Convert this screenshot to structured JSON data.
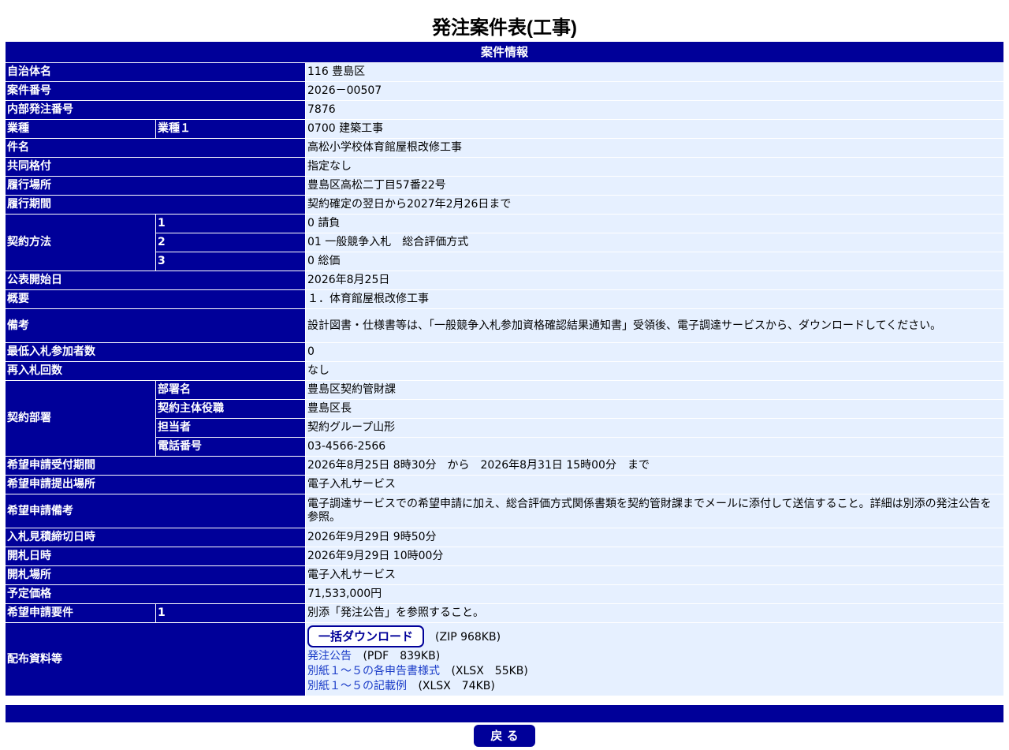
{
  "page": {
    "title": "発注案件表(工事)"
  },
  "section": {
    "title": "案件情報"
  },
  "rows": {
    "jichitai": {
      "label": "自治体名",
      "value": "116 豊島区"
    },
    "anken_no": {
      "label": "案件番号",
      "value": "2026－00507"
    },
    "naibu_no": {
      "label": "内部発注番号",
      "value": "7876"
    },
    "gyoshu": {
      "label": "業種",
      "sub": "業種１",
      "value": "0700 建築工事"
    },
    "kenmei": {
      "label": "件名",
      "value": "高松小学校体育館屋根改修工事"
    },
    "kyodo": {
      "label": "共同格付",
      "value": "指定なし"
    },
    "basho": {
      "label": "履行場所",
      "value": "豊島区高松二丁目57番22号"
    },
    "kikan": {
      "label": "履行期間",
      "value": "契約確定の翌日から2027年2月26日まで"
    },
    "hoho": {
      "label": "契約方法",
      "items": [
        {
          "sub": "1",
          "value": "0 請負"
        },
        {
          "sub": "2",
          "value": "01 一般競争入札　総合評価方式"
        },
        {
          "sub": "3",
          "value": "0 総価"
        }
      ]
    },
    "kohyo": {
      "label": "公表開始日",
      "value": "2026年8月25日"
    },
    "gaiyo": {
      "label": "概要",
      "value": "１．体育館屋根改修工事"
    },
    "biko": {
      "label": "備考",
      "value": "設計図書・仕様書等は、「一般競争入札参加資格確認結果通知書」受領後、電子調達サービスから、ダウンロードしてください。"
    },
    "saitei": {
      "label": "最低入札参加者数",
      "value": "0"
    },
    "sainyusatsu": {
      "label": "再入札回数",
      "value": "なし"
    },
    "busho": {
      "label": "契約部署",
      "items": [
        {
          "sub": "部署名",
          "value": "豊島区契約管財課"
        },
        {
          "sub": "契約主体役職",
          "value": "豊島区長"
        },
        {
          "sub": "担当者",
          "value": "契約グループ山形"
        },
        {
          "sub": "電話番号",
          "value": "03-4566-2566"
        }
      ]
    },
    "kibo_kikan": {
      "label": "希望申請受付期間",
      "value": "2026年8月25日 8時30分　から　2026年8月31日 15時00分　まで"
    },
    "kibo_basho": {
      "label": "希望申請提出場所",
      "value": "電子入札サービス"
    },
    "kibo_biko": {
      "label": "希望申請備考",
      "value": "電子調達サービスでの希望申請に加え、総合評価方式関係書類を契約管財課までメールに添付して送信すること。詳細は別添の発注公告を参照。"
    },
    "shimekiri": {
      "label": "入札見積締切日時",
      "value": "2026年9月29日 9時50分"
    },
    "kaisatsu": {
      "label": "開札日時",
      "value": "2026年9月29日 10時00分"
    },
    "kaisatsu_basho": {
      "label": "開札場所",
      "value": "電子入札サービス"
    },
    "yotei": {
      "label": "予定価格",
      "value": "71,533,000円"
    },
    "kibo_yoken": {
      "label": "希望申請要件",
      "sub": "1",
      "value": "別添「発注公告」を参照すること。"
    },
    "haifu": {
      "label": "配布資料等",
      "bulk_label": "一括ダウンロード",
      "bulk_size": "(ZIP 968KB)",
      "docs": [
        {
          "name": "発注公告",
          "size": "(PDF　839KB)"
        },
        {
          "name": "別紙１～５の各申告書様式",
          "size": "(XLSX　55KB)"
        },
        {
          "name": "別紙１～５の記載例",
          "size": "(XLSX　74KB)"
        }
      ]
    }
  },
  "footer": {
    "back_label": "戻 る"
  }
}
